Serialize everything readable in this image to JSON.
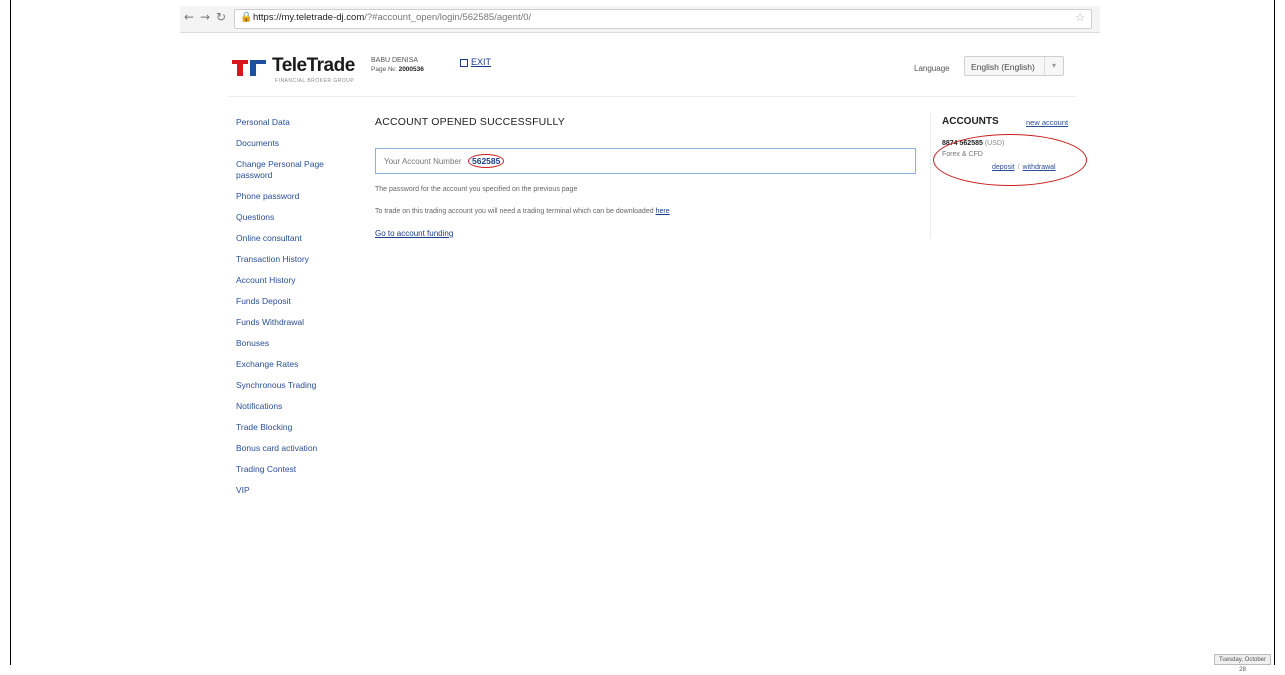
{
  "browser": {
    "url_host": "https://my.teletrade-dj.com",
    "url_path": "/?#account_open/login/562585/agent/0/"
  },
  "header": {
    "logo_text": "TeleTrade",
    "logo_subtext": "FINANCIAL BROKER GROUP",
    "user_name": "BABU DENISA",
    "page_label": "Page №:",
    "page_number": "2000536",
    "exit_label": "EXIT",
    "language_label": "Language",
    "language_value": "English (English)"
  },
  "sidebar": {
    "items": [
      "Personal Data",
      "Documents",
      "Change Personal Page password",
      "Phone password",
      "Questions",
      "Online consultant",
      "Transaction History",
      "Account History",
      "Funds Deposit",
      "Funds Withdrawal",
      "Bonuses",
      "Exchange Rates",
      "Synchronous Trading",
      "Notifications",
      "Trade Blocking",
      "Bonus card activation",
      "Trading Contest",
      "VIP"
    ]
  },
  "main": {
    "title": "ACCOUNT OPENED SUCCESSFULLY",
    "account_label": "Your Account Number",
    "account_number": "562585",
    "info_password": "The password for the account you specified on the previous page",
    "info_terminal": "To trade on this trading account you will need a trading terminal which can be downloaded",
    "info_terminal_link": "here",
    "goto_link": "Go to account funding"
  },
  "accounts": {
    "title": "ACCOUNTS",
    "new_account": "new account",
    "account_line": "8874 562585",
    "currency": "(USD)",
    "type": "Forex & CFD",
    "deposit": "deposit",
    "withdrawal": "withdrawal"
  },
  "taskbar": {
    "clock": "Tuesday, October 28"
  },
  "colors": {
    "link": "#2a4f99",
    "highlight": "#cc1f1f",
    "logo_red": "#d7191c",
    "logo_blue": "#1f4fa0"
  }
}
